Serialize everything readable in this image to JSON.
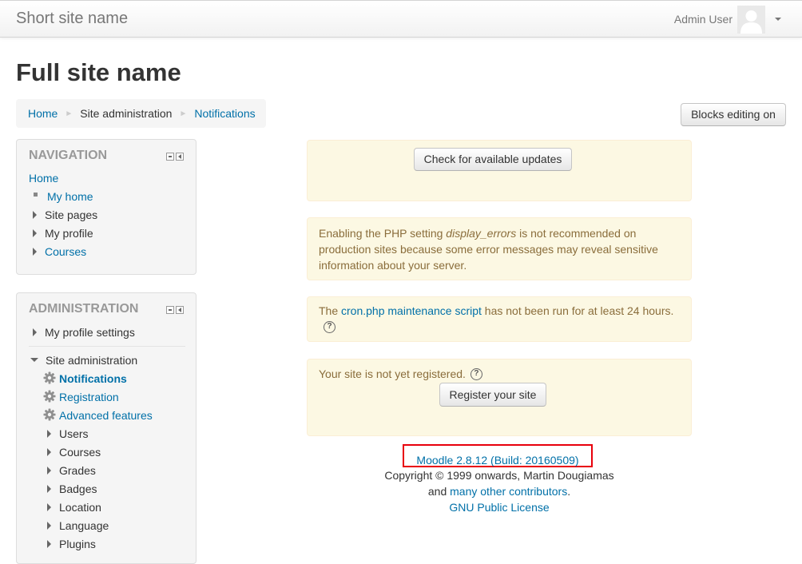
{
  "header": {
    "brand": "Short site name",
    "user_name": "Admin User",
    "avatar_icon": "user-avatar-icon",
    "menu_icon": "caret-down-icon"
  },
  "page": {
    "title": "Full site name",
    "blocks_editing_label": "Blocks editing on"
  },
  "breadcrumb": {
    "home": "Home",
    "site_admin": "Site administration",
    "current": "Notifications"
  },
  "navigation": {
    "title": "NAVIGATION",
    "home": "Home",
    "items": [
      {
        "label": "My home",
        "icon": "bullet-icon",
        "is_link": true
      },
      {
        "label": "Site pages",
        "icon": "expand-arrow-icon",
        "is_link": false
      },
      {
        "label": "My profile",
        "icon": "expand-arrow-icon",
        "is_link": false
      },
      {
        "label": "Courses",
        "icon": "expand-arrow-icon",
        "is_link": true
      }
    ]
  },
  "administration": {
    "title": "ADMINISTRATION",
    "my_profile_settings": "My profile settings",
    "site_administration": "Site administration",
    "gear_items": [
      "Notifications",
      "Registration",
      "Advanced features"
    ],
    "collapsed_items": [
      "Users",
      "Courses",
      "Grades",
      "Badges",
      "Location",
      "Language",
      "Plugins"
    ]
  },
  "notices": {
    "updates_button": "Check for available updates",
    "display_errors_pre": "Enabling the PHP setting ",
    "display_errors_setting": "display_errors",
    "display_errors_post": " is not recommended on production sites because some error messages may reveal sensitive information about your server.",
    "cron_pre": "The ",
    "cron_link": "cron.php maintenance script",
    "cron_post": " has not been run for at least 24 hours.",
    "registration_text": "Your site is not yet registered.",
    "register_button": "Register your site",
    "help_glyph": "?"
  },
  "footer": {
    "version": "Moodle 2.8.12 (Build: 20160509)",
    "copyright": "Copyright © 1999 onwards, Martin Dougiamas",
    "and_text": "and ",
    "contributors": "many other contributors",
    "period": ".",
    "license": "GNU Public License"
  },
  "colors": {
    "link": "#0070a8",
    "notice_bg": "#fcf8e3",
    "notice_text": "#8a6d3b",
    "highlight_box": "#e8000b"
  }
}
